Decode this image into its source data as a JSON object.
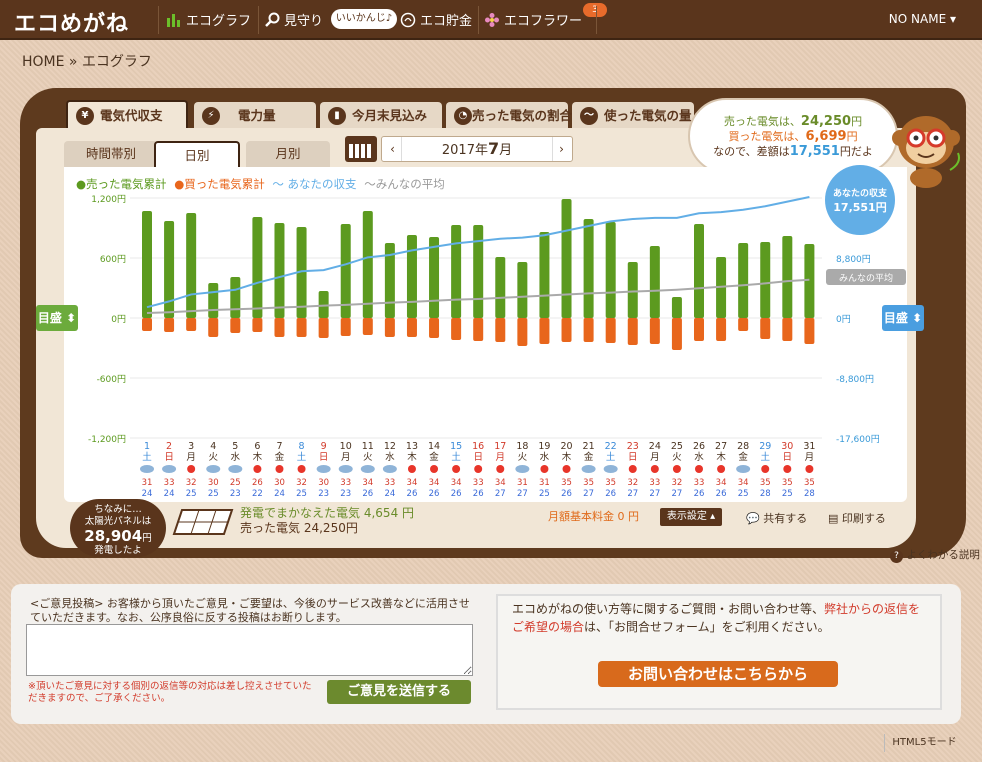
{
  "nav": {
    "logo": "エコめがね",
    "items": [
      {
        "label": "エコグラフ",
        "icon": "bar-chart-icon"
      },
      {
        "label": "見守り",
        "icon": "magnifier-icon"
      },
      {
        "label": "エコ貯金",
        "icon": "coin-icon"
      },
      {
        "label": "エコフラワー",
        "icon": "flower-icon"
      }
    ],
    "mimamori_status": "いいかんじ♪",
    "flower_badge": "3",
    "user": "NO NAME ▾"
  },
  "breadcrumb": "HOME » エコグラフ",
  "main_tabs": [
    {
      "label": "電気代収支",
      "icon": "yen-icon"
    },
    {
      "label": "電力量",
      "icon": "bolt-icon"
    },
    {
      "label": "今月末見込み",
      "icon": "forecast-icon"
    },
    {
      "label": "売った電気の割合",
      "icon": "pie-icon"
    },
    {
      "label": "使った電気の量",
      "icon": "wave-icon"
    }
  ],
  "sub_tabs": [
    "時間帯別",
    "日別",
    "月別"
  ],
  "month": {
    "year": "2017年",
    "month": "7",
    "suffix": "月"
  },
  "summary": {
    "sold_pre": "売った電気は、",
    "sold": "24,250",
    "sold_unit": "円",
    "bought_pre": "買った電気は、",
    "bought": "6,699",
    "bought_unit": "円",
    "diff_pre": "なので、差額は",
    "diff": "17,551",
    "diff_unit": "円だよ"
  },
  "meimori_label": "目盛",
  "chart_data": {
    "type": "bar",
    "legend": [
      "●売った電気累計",
      "●買った電気累計",
      "〜 あなたの収支",
      "〜みんなの平均"
    ],
    "left_axis": {
      "ticks": [
        1200,
        600,
        0,
        -600,
        -1200
      ],
      "labels": [
        "1,200円",
        "600円",
        "0円",
        "-600円",
        "-1,200円"
      ]
    },
    "right_axis": {
      "labels": [
        "8,800円",
        "0円",
        "-8,800円",
        "-17,600円"
      ],
      "ticks": [
        8800,
        0,
        -8800,
        -17600
      ]
    },
    "x": [
      "1",
      "2",
      "3",
      "4",
      "5",
      "6",
      "7",
      "8",
      "9",
      "10",
      "11",
      "12",
      "13",
      "14",
      "15",
      "16",
      "17",
      "18",
      "19",
      "20",
      "21",
      "22",
      "23",
      "24",
      "25",
      "26",
      "27",
      "28",
      "29",
      "30",
      "31"
    ],
    "weekday": [
      "土",
      "日",
      "月",
      "火",
      "水",
      "木",
      "金",
      "土",
      "日",
      "月",
      "火",
      "水",
      "木",
      "金",
      "土",
      "日",
      "月",
      "火",
      "水",
      "木",
      "金",
      "土",
      "日",
      "月",
      "火",
      "水",
      "木",
      "金",
      "土",
      "日",
      "月"
    ],
    "day_type": [
      "sat",
      "sun",
      "w",
      "w",
      "w",
      "w",
      "w",
      "sat",
      "sun",
      "w",
      "w",
      "w",
      "w",
      "w",
      "sat",
      "sun",
      "hol",
      "w",
      "w",
      "w",
      "w",
      "sat",
      "sun",
      "w",
      "w",
      "w",
      "w",
      "w",
      "sat",
      "sun",
      "w"
    ],
    "weather": [
      "cloud",
      "cloud",
      "sun",
      "cloud",
      "cloud",
      "sun",
      "sun",
      "sun",
      "cloud",
      "cloud",
      "cloud",
      "cloud",
      "sun",
      "sun",
      "sun",
      "sun",
      "sun",
      "cloud",
      "sun",
      "sun",
      "cloud",
      "cloud",
      "sun",
      "sun",
      "sun",
      "sun",
      "sun",
      "cloud",
      "sun",
      "sun",
      "sun"
    ],
    "temp_high": [
      "31",
      "33",
      "32",
      "30",
      "25",
      "26",
      "30",
      "32",
      "30",
      "33",
      "34",
      "33",
      "34",
      "34",
      "34",
      "33",
      "34",
      "31",
      "31",
      "35",
      "35",
      "35",
      "32",
      "33",
      "32",
      "33",
      "34",
      "34",
      "35",
      "35",
      "35"
    ],
    "temp_low": [
      "24",
      "24",
      "25",
      "25",
      "23",
      "22",
      "24",
      "25",
      "23",
      "23",
      "26",
      "24",
      "26",
      "26",
      "26",
      "26",
      "27",
      "27",
      "25",
      "26",
      "27",
      "26",
      "27",
      "27",
      "27",
      "26",
      "26",
      "25",
      "28",
      "25",
      "28"
    ],
    "sold": [
      1070,
      970,
      1050,
      350,
      410,
      1010,
      950,
      910,
      270,
      940,
      1070,
      750,
      830,
      810,
      930,
      930,
      610,
      560,
      860,
      1190,
      990,
      960,
      560,
      720,
      210,
      940,
      610,
      750,
      760,
      820,
      740
    ],
    "bought": [
      -130,
      -140,
      -130,
      -190,
      -150,
      -140,
      -190,
      -190,
      -200,
      -180,
      -170,
      -190,
      -190,
      -200,
      -220,
      -230,
      -240,
      -280,
      -260,
      -240,
      -240,
      -250,
      -270,
      -260,
      -320,
      -230,
      -230,
      -130,
      -210,
      -230,
      -260
    ],
    "your_balance_pct": [
      0.05,
      0.1,
      0.16,
      0.18,
      0.2,
      0.26,
      0.31,
      0.36,
      0.37,
      0.42,
      0.48,
      0.5,
      0.54,
      0.57,
      0.6,
      0.62,
      0.64,
      0.65,
      0.67,
      0.71,
      0.75,
      0.79,
      0.81,
      0.82,
      0.82,
      0.86,
      0.87,
      0.89,
      0.92,
      0.96,
      1.0
    ],
    "avg_pct": [
      0.0,
      0.02,
      0.05,
      0.08,
      0.1,
      0.12,
      0.15,
      0.17,
      0.2,
      0.22,
      0.25,
      0.28,
      0.3,
      0.33,
      0.36,
      0.38,
      0.41,
      0.44,
      0.47,
      0.5,
      0.53,
      0.55,
      0.58,
      0.6,
      0.63,
      0.67,
      0.71,
      0.75,
      0.8,
      0.86,
      0.9
    ],
    "end_label_you": [
      "あなたの収支",
      "17,551円"
    ],
    "end_label_avg": "みんなの平均"
  },
  "solar": {
    "line1": "ちなみに…",
    "line2": "太陽光パネルは",
    "amount": "28,904",
    "unit": "円",
    "line4": "発電したよ",
    "gen_label": "発電でまかなえた電気",
    "gen_value": "4,654 円",
    "sold_label": "売った電気",
    "sold_value": "24,250円"
  },
  "basic_fee": "月額基本料金 0 円",
  "buttons": {
    "display_setting": "表示設定 ▴",
    "share": "共有する",
    "print": "印刷する",
    "help": "よくわかる説明"
  },
  "feedback": {
    "text": "<ご意見投稿> お客様から頂いたご意見・ご要望は、今後のサービス改善などに活用させていただきます。なお、公序良俗に反する投稿はお断りします。",
    "note": "※頂いたご意見に対する個別の返信等の対応は差し控えさせていただきますので、ご了承ください。",
    "submit": "ご意見を送信する"
  },
  "contact": {
    "text1": "エコめがねの使い方等に関するご質問・お問い合わせ等、",
    "red": "弊社からの返信をご希望の場合",
    "text2": "は、「お問合せフォーム」をご利用ください。",
    "button": "お問い合わせはこちらから"
  },
  "html5": "HTML5モード",
  "colors": {
    "green": "#5c9a1f",
    "orange": "#e8661c",
    "blue": "#62aee6",
    "gray": "#aaaaaa",
    "brown": "#5a351c"
  }
}
